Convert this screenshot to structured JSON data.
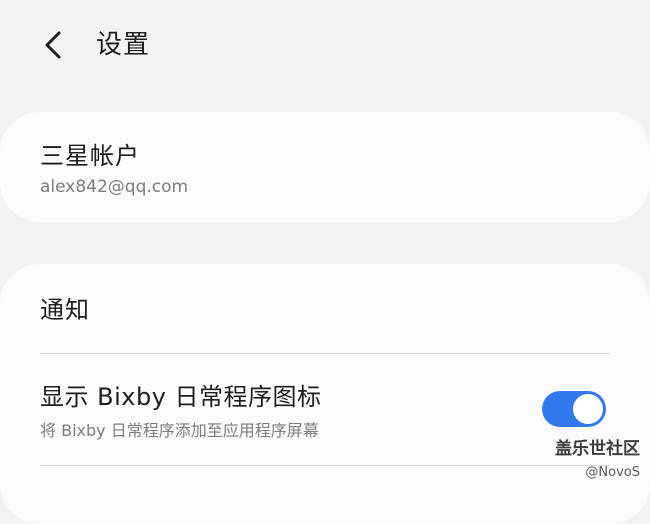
{
  "header": {
    "title": "设置"
  },
  "account": {
    "name": "三星帐户",
    "email": "alex842@qq.com"
  },
  "settings": {
    "items": [
      {
        "label": "通知"
      },
      {
        "label": "显示 Bixby 日常程序图标",
        "sublabel": "将 Bixby 日常程序添加至应用程序屏幕",
        "toggle_on": true
      }
    ]
  },
  "colors": {
    "accent": "#3478ee",
    "background": "#f2f2f2",
    "card": "#fbfbfb",
    "secondary_text": "#7d7d7d"
  },
  "icons": {
    "back": "chevron-left-icon"
  },
  "watermark": {
    "title": "盖乐世社区",
    "author": "@NovoS"
  }
}
